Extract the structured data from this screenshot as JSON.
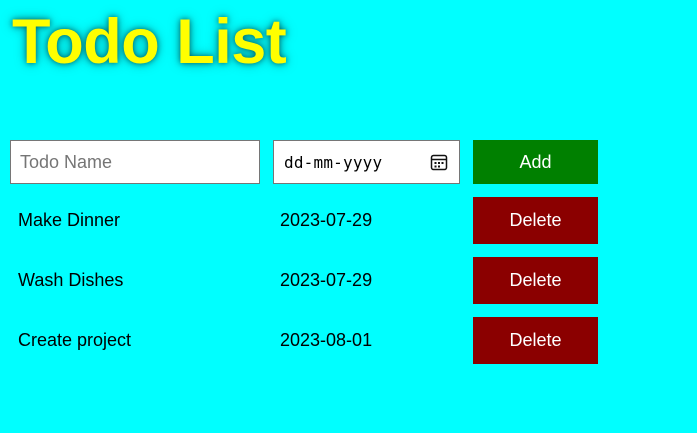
{
  "header": {
    "title": "Todo List"
  },
  "form": {
    "name_placeholder": "Todo Name",
    "name_value": "",
    "date_placeholder": "dd-mm-yyyy",
    "add_label": "Add"
  },
  "todos": [
    {
      "name": "Make Dinner",
      "date": "2023-07-29",
      "delete_label": "Delete"
    },
    {
      "name": "Wash Dishes",
      "date": "2023-07-29",
      "delete_label": "Delete"
    },
    {
      "name": "Create project",
      "date": "2023-08-01",
      "delete_label": "Delete"
    }
  ],
  "colors": {
    "background": "#00ffff",
    "title": "#ffff00",
    "add_button": "#008000",
    "delete_button": "#8b0000"
  },
  "icons": {
    "date_picker": "calendar-icon"
  }
}
